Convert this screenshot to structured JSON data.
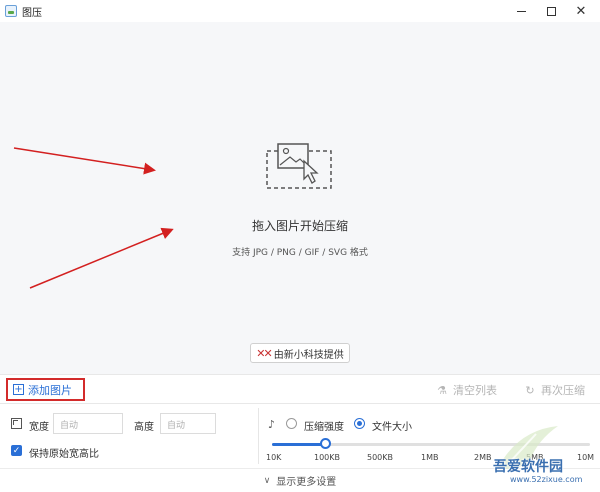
{
  "window": {
    "title": "图压"
  },
  "dropzone": {
    "title": "拖入图片开始压缩",
    "subtitle": "支持 JPG / PNG / GIF / SVG 格式",
    "credit": "由新小科技提供"
  },
  "toolbar": {
    "add_label": "添加图片",
    "clear_label": "清空列表",
    "recompress_label": "再次压缩"
  },
  "settings": {
    "width_label": "宽度",
    "width_placeholder": "自动",
    "height_label": "高度",
    "height_placeholder": "自动",
    "keep_ratio_label": "保持原始宽高比",
    "keep_ratio_checked": true,
    "mode_strength_label": "压缩强度",
    "mode_filesize_label": "文件大小",
    "selected_mode": "文件大小",
    "slider_ticks": [
      "10K",
      "100KB",
      "500KB",
      "1MB",
      "2MB",
      "5MB",
      "10M"
    ],
    "slider_value": "100KB",
    "more_label": "显示更多设置"
  },
  "watermark": {
    "name": "吾爱软件园",
    "url": "www.52zixue.com"
  },
  "colors": {
    "accent": "#2a6fd6",
    "highlight_red": "#d32b2b",
    "dropzone_bg": "#f6f7f9"
  }
}
